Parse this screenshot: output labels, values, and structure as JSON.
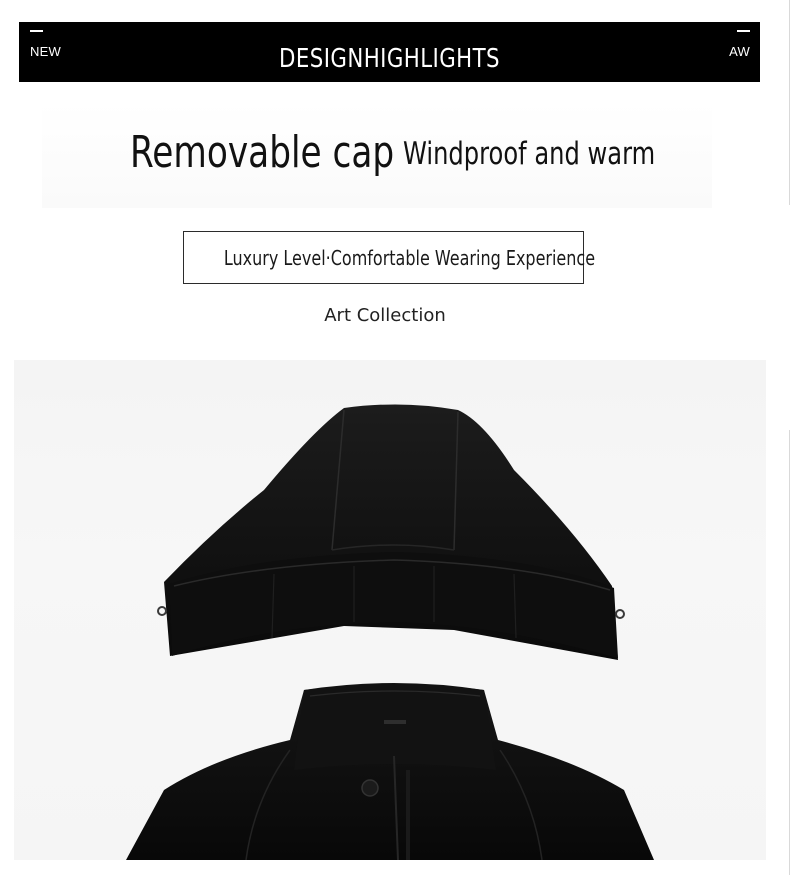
{
  "banner": {
    "left_tag": "NEW",
    "right_tag": "AW",
    "title": "DESIGNHIGHLIGHTS"
  },
  "highlight": {
    "headline": "Removable cap",
    "subheadline": "Windproof and warm"
  },
  "tagline": "Luxury Level·Comfortable Wearing Experience",
  "collection": "Art Collection",
  "photo": {
    "subject": "detachable-hood-jacket",
    "colors": {
      "fabric": "#0d0d0d",
      "background": "#f5f5f5"
    }
  }
}
